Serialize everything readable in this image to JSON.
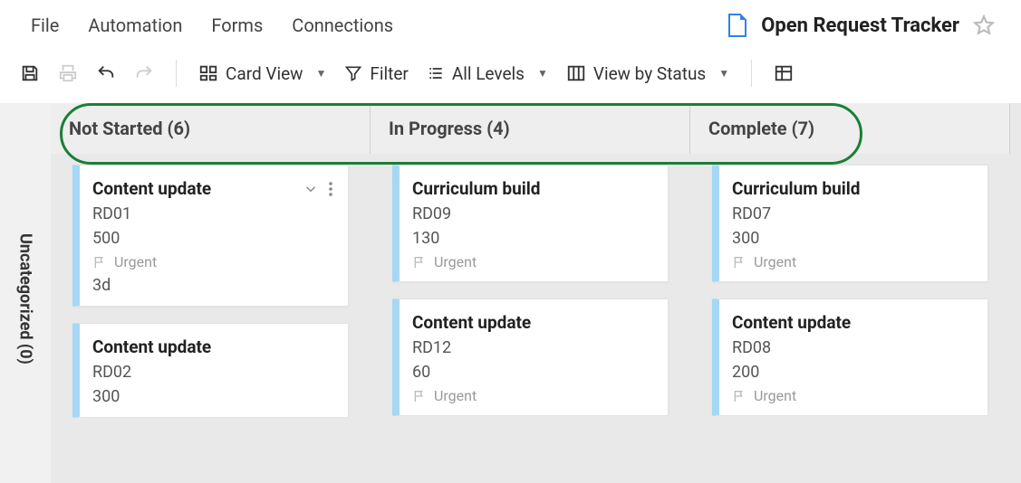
{
  "menu": {
    "file": "File",
    "automation": "Automation",
    "forms": "Forms",
    "connections": "Connections"
  },
  "header": {
    "title": "Open Request Tracker"
  },
  "toolbar": {
    "card_view": "Card View",
    "filter": "Filter",
    "all_levels": "All Levels",
    "view_by_status": "View by Status"
  },
  "sidebar": {
    "uncategorized": "Uncategorized (0)"
  },
  "columns": [
    {
      "header": "Not Started (6)",
      "cards": [
        {
          "title": "Content update",
          "id": "RD01",
          "value": "500",
          "flag": "Urgent",
          "extra": "3d",
          "show_actions": true
        },
        {
          "title": "Content update",
          "id": "RD02",
          "value": "300",
          "flag": "",
          "extra": "",
          "show_actions": false
        }
      ]
    },
    {
      "header": "In Progress (4)",
      "cards": [
        {
          "title": "Curriculum build",
          "id": "RD09",
          "value": "130",
          "flag": "Urgent",
          "extra": "",
          "show_actions": false
        },
        {
          "title": "Content update",
          "id": "RD12",
          "value": "60",
          "flag": "Urgent",
          "extra": "",
          "show_actions": false
        }
      ]
    },
    {
      "header": "Complete (7)",
      "cards": [
        {
          "title": "Curriculum build",
          "id": "RD07",
          "value": "300",
          "flag": "Urgent",
          "extra": "",
          "show_actions": false
        },
        {
          "title": "Content update",
          "id": "RD08",
          "value": "200",
          "flag": "Urgent",
          "extra": "",
          "show_actions": false
        }
      ]
    }
  ]
}
